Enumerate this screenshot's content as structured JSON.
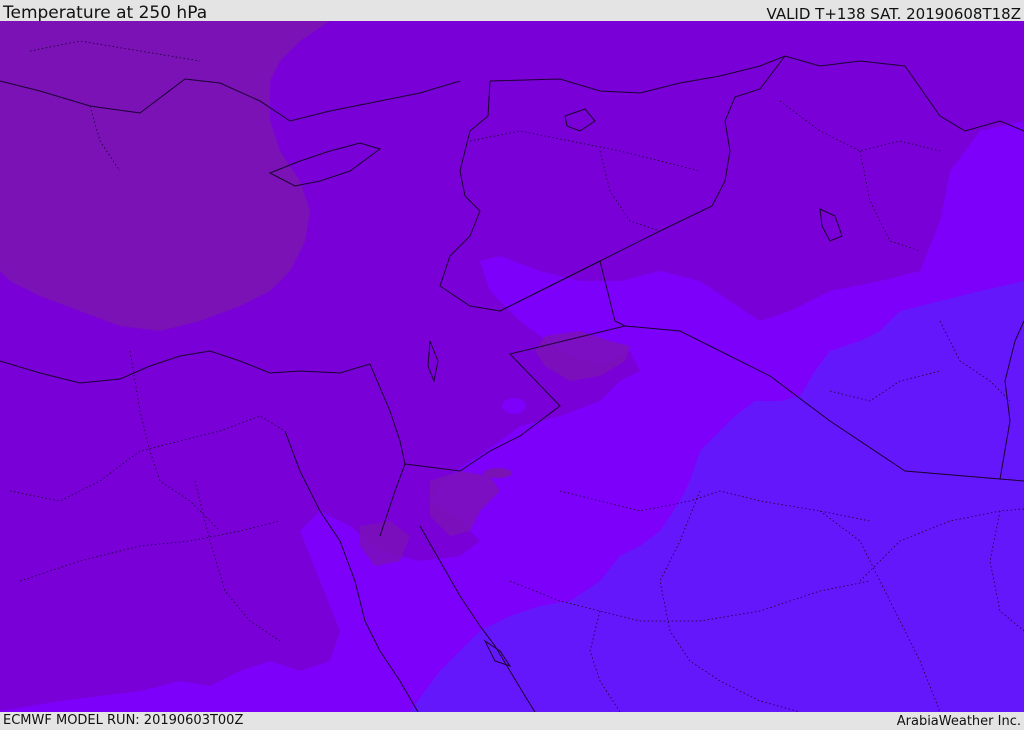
{
  "header": {
    "title": "Temperature at 250 hPa",
    "valid": "VALID T+138 SAT. 20190608T18Z"
  },
  "footer": {
    "model_run": "ECMWF MODEL RUN: 20190603T00Z",
    "credit": "ArabiaWeather Inc."
  },
  "map": {
    "colors": {
      "warm_core": "#7a12b6",
      "mid_purple": "#7a00d8",
      "violet": "#7d00fb",
      "cool_blue": "#6517fb",
      "border": "#1a0030"
    }
  }
}
